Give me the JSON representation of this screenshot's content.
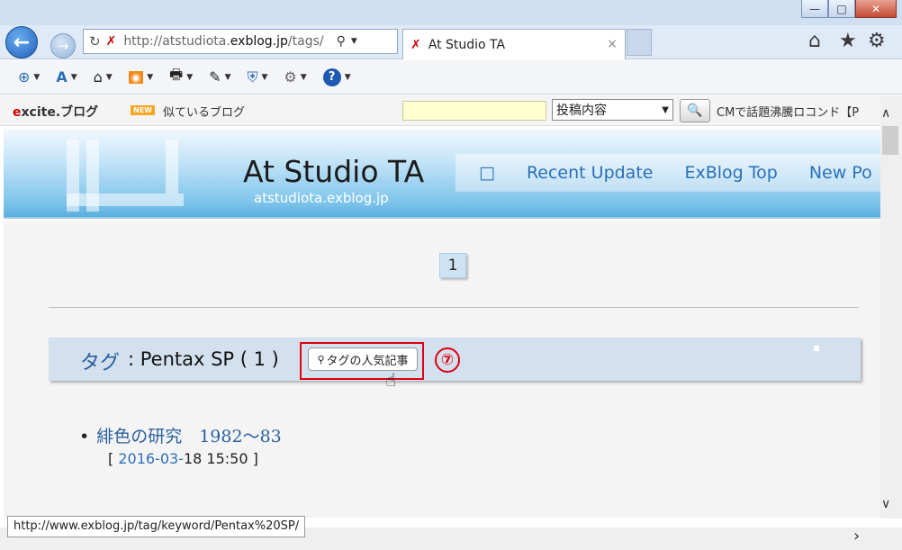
{
  "window": {
    "minimize": "—",
    "maximize": "□",
    "close": "✕"
  },
  "nav": {
    "address_prefix": "http://atstudiota.",
    "address_domain": "exblog.jp",
    "address_suffix": "/tags/",
    "tab_title": "At Studio TA",
    "tab_close": "×"
  },
  "excite": {
    "logo_e": "e",
    "logo_rest": "xcite.ブログ",
    "new_badge": "NEW",
    "similar": "似ているブログ",
    "select_value": "投稿内容",
    "cm_text": "CMで話題沸騰ロコンド【P"
  },
  "blog": {
    "title": "At Studio TA",
    "subtitle": "atstudiota.exblog.jp",
    "links": [
      "□",
      "Recent Update",
      "ExBlog Top",
      "New Po"
    ]
  },
  "page": {
    "page_number": "1",
    "tag_label": "タグ",
    "tag_name": ": Pentax SP ( 1 )",
    "tag_button": "タグの人気記事",
    "annotation": "⑦",
    "post_title": "緋色の研究　1982〜83",
    "post_date_open": "[ ",
    "post_date_link": "2016-03-",
    "post_date_rest": "18 15:50 ]"
  },
  "status_url": "http://www.exblog.jp/tag/keyword/Pentax%20SP/"
}
